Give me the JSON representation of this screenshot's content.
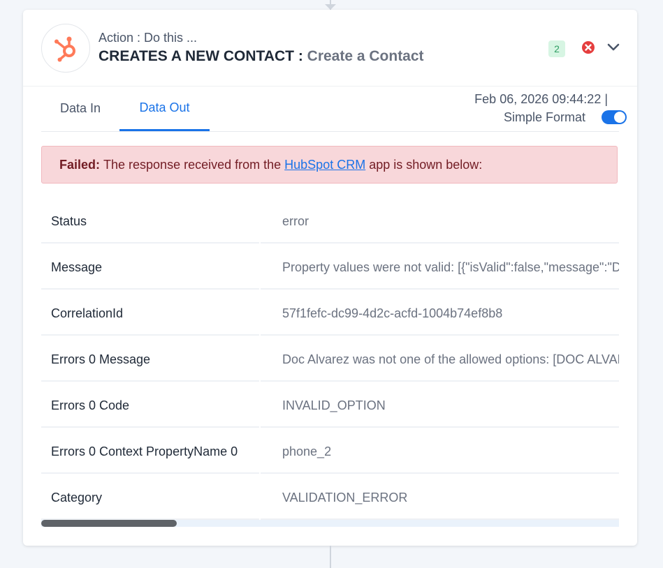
{
  "header": {
    "action_label": "Action : Do this ...",
    "title_main": "CREATES A NEW CONTACT :",
    "title_sub": "Create a Contact",
    "count_badge": "2",
    "app_icon": "hubspot-logo",
    "status_icon": "error-x-icon",
    "toggle_icon": "chevron-down-icon"
  },
  "tabs": [
    {
      "label": "Data In",
      "active": false
    },
    {
      "label": "Data Out",
      "active": true
    }
  ],
  "meta": {
    "timestamp": "Feb 06, 2026 09:44:22  |",
    "format_label": "Simple Format",
    "format_enabled": true
  },
  "alert": {
    "prefix": "Failed:",
    "text_before": "The response received from the",
    "link": "HubSpot CRM",
    "text_after": "app is shown below:"
  },
  "rows": [
    {
      "key": "Status",
      "value": "error"
    },
    {
      "key": "Message",
      "value": "Property values were not valid: [{\"isValid\":false,\"message\":\"Doc Alvarez was not one of the allowed options"
    },
    {
      "key": "CorrelationId",
      "value": "57f1fefc-dc99-4d2c-acfd-1004b74ef8b8"
    },
    {
      "key": "Errors 0 Message",
      "value": "Doc Alvarez was not one of the allowed options: [DOC ALVAREZ"
    },
    {
      "key": "Errors 0 Code",
      "value": "INVALID_OPTION"
    },
    {
      "key": "Errors 0 Context PropertyName 0",
      "value": "phone_2"
    },
    {
      "key": "Category",
      "value": "VALIDATION_ERROR"
    }
  ],
  "colors": {
    "accent": "#1a73e8",
    "hubspot_orange": "#ff7a59",
    "error_red": "#e53e3e",
    "alert_bg": "#f8d7da",
    "badge_bg": "#d7f5e3"
  }
}
